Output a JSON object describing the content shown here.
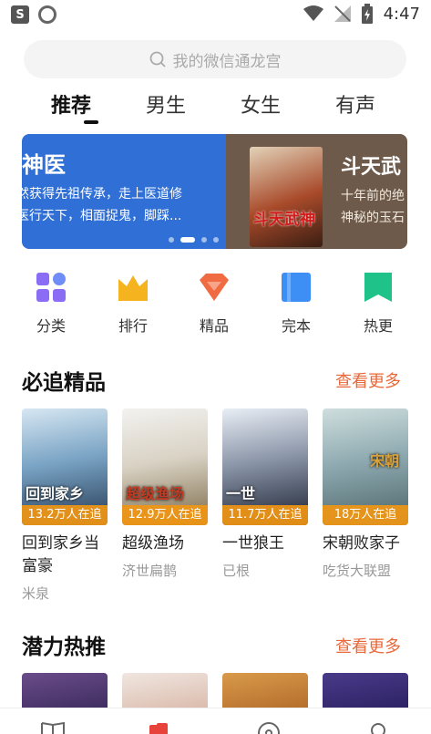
{
  "status_bar": {
    "time": "4:47",
    "app_icon_letter": "S"
  },
  "search": {
    "placeholder": "我的微信通龙宫"
  },
  "tabs": [
    {
      "label": "推荐",
      "active": true
    },
    {
      "label": "男生"
    },
    {
      "label": "女生"
    },
    {
      "label": "有声"
    }
  ],
  "banner": {
    "slide1": {
      "title": "神医",
      "desc_line1": "然获得先祖传承，走上医道修",
      "desc_line2": "医行天下，相面捉鬼，脚踩..."
    },
    "slide2": {
      "cover_text": "斗天武神",
      "title": "斗天武",
      "desc_line1": "十年前的绝",
      "desc_line2": "神秘的玉石"
    },
    "dot_count": 4,
    "active_dot": 1
  },
  "categories": [
    {
      "label": "分类",
      "icon": "grid-icon",
      "color": "#8b6cf5"
    },
    {
      "label": "排行",
      "icon": "crown-icon",
      "color": "#f5b41f"
    },
    {
      "label": "精品",
      "icon": "diamond-icon",
      "color": "#f06a42"
    },
    {
      "label": "完本",
      "icon": "book-icon",
      "color": "#3d8ff5"
    },
    {
      "label": "热更",
      "icon": "bookmark-icon",
      "color": "#1fc38a"
    }
  ],
  "section1": {
    "title": "必追精品",
    "more": "查看更多",
    "books": [
      {
        "title": "回到家乡当富豪",
        "author": "米泉",
        "badge": "13.2万人在追",
        "cover_text": "回到家乡"
      },
      {
        "title": "超级渔场",
        "author": "济世扁鹊",
        "badge": "12.9万人在追",
        "cover_text": "超级渔场"
      },
      {
        "title": "一世狼王",
        "author": "已根",
        "badge": "11.7万人在追",
        "cover_text": "一世"
      },
      {
        "title": "宋朝败家子",
        "author": "吃货大联盟",
        "badge": "18万人在追",
        "cover_text": "宋朝"
      }
    ]
  },
  "section2": {
    "title": "潜力热推",
    "more": "查看更多"
  },
  "colors": {
    "accent": "#e8683a",
    "badge": "#f0961a",
    "banner_blue": "#2f6fd6"
  }
}
